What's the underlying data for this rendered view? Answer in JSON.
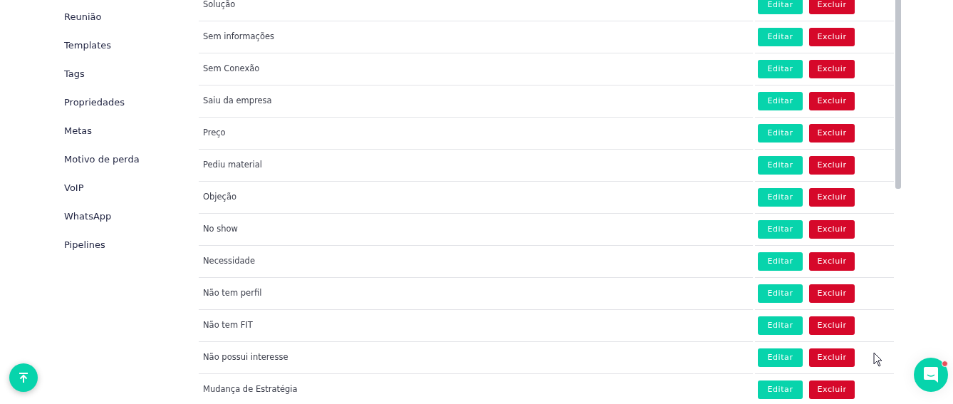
{
  "sidebar": {
    "items": [
      {
        "label": "Reunião"
      },
      {
        "label": "Templates"
      },
      {
        "label": "Tags"
      },
      {
        "label": "Propriedades"
      },
      {
        "label": "Metas"
      },
      {
        "label": "Motivo de perda"
      },
      {
        "label": "VoIP"
      },
      {
        "label": "WhatsApp"
      },
      {
        "label": "Pipelines"
      }
    ]
  },
  "table": {
    "rows": [
      {
        "name": "Solução",
        "edit": "Editar",
        "delete": "Excluir"
      },
      {
        "name": "Sem informações",
        "edit": "Editar",
        "delete": "Excluir"
      },
      {
        "name": "Sem Conexão",
        "edit": "Editar",
        "delete": "Excluir"
      },
      {
        "name": "Saiu da empresa",
        "edit": "Editar",
        "delete": "Excluir"
      },
      {
        "name": "Preço",
        "edit": "Editar",
        "delete": "Excluir"
      },
      {
        "name": "Pediu material",
        "edit": "Editar",
        "delete": "Excluir"
      },
      {
        "name": "Objeção",
        "edit": "Editar",
        "delete": "Excluir"
      },
      {
        "name": "No show",
        "edit": "Editar",
        "delete": "Excluir"
      },
      {
        "name": "Necessidade",
        "edit": "Editar",
        "delete": "Excluir"
      },
      {
        "name": "Não tem perfil",
        "edit": "Editar",
        "delete": "Excluir"
      },
      {
        "name": "Não tem FIT",
        "edit": "Editar",
        "delete": "Excluir"
      },
      {
        "name": "Não possui interesse",
        "edit": "Editar",
        "delete": "Excluir"
      },
      {
        "name": "Mudança de Estratégia",
        "edit": "Editar",
        "delete": "Excluir"
      }
    ]
  },
  "chat": {
    "unread": true
  }
}
